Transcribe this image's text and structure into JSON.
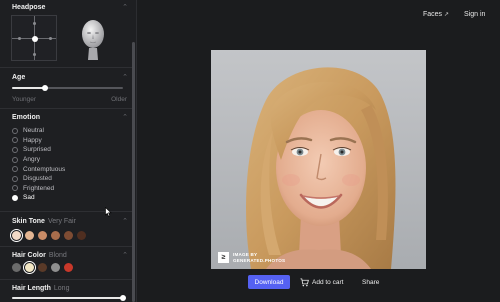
{
  "header": {
    "faces_label": "Faces",
    "signin_label": "Sign in"
  },
  "sidebar": {
    "headpose": {
      "title": "Headpose"
    },
    "age": {
      "title": "Age",
      "min_label": "Younger",
      "max_label": "Older",
      "value_fraction": 0.3
    },
    "emotion": {
      "title": "Emotion",
      "options": [
        "Neutral",
        "Happy",
        "Surprised",
        "Angry",
        "Contemptuous",
        "Disgusted",
        "Frightened",
        "Sad"
      ],
      "selected": "Sad"
    },
    "skin_tone": {
      "title": "Skin Tone",
      "selected_label": "Very Fair",
      "swatches": [
        "#f2d9c6",
        "#e3b592",
        "#c98c67",
        "#a86d4c",
        "#7e4c33",
        "#4f2e20"
      ]
    },
    "hair_color": {
      "title": "Hair Color",
      "selected_label": "Blond",
      "swatches": [
        "#6b6b6b",
        "#f1e6c4",
        "#5a3a28",
        "#8f8f8f",
        "#c8382a"
      ]
    },
    "hair_length": {
      "title": "Hair Length",
      "selected_label": "Long",
      "value_fraction": 1.0
    }
  },
  "watermark": {
    "line1": "IMAGE BY",
    "line2": "GENERATED.PHOTOS",
    "logo_glyph": "≥"
  },
  "actions": {
    "download_label": "Download",
    "cart_label": "Add to cart",
    "share_label": "Share"
  },
  "colors": {
    "accent": "#5561f2",
    "background": "#1b1c1e",
    "panel": "#1e1f22"
  }
}
